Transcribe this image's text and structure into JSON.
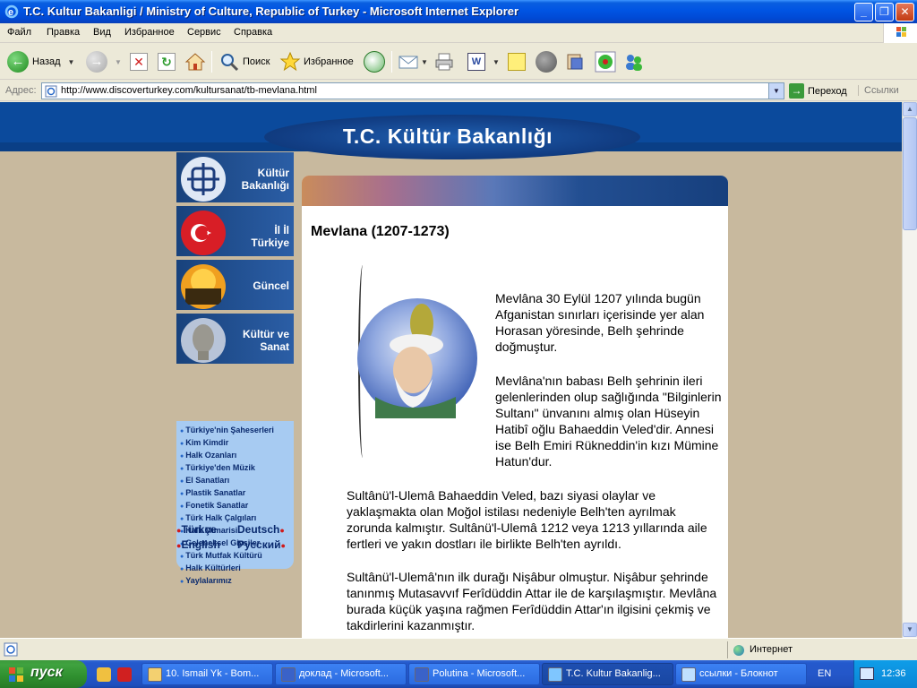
{
  "window": {
    "title": "T.C. Kultur Bakanligi / Ministry of Culture, Republic of Turkey - Microsoft Internet Explorer",
    "minimize": "_",
    "restore": "❐",
    "close": "✕"
  },
  "menu": [
    "Файл",
    "Правка",
    "Вид",
    "Избранное",
    "Сервис",
    "Справка"
  ],
  "toolbar": {
    "back_label": "Назад",
    "search_label": "Поиск",
    "favorites_label": "Избранное"
  },
  "address": {
    "label": "Адрес:",
    "url": "http://www.discoverturkey.com/kultursanat/tb-mevlana.html",
    "go_label": "Переход",
    "links_label": "Ссылки"
  },
  "page": {
    "banner_title": "T.C. Kültür Bakanlığı",
    "nav_tiles": [
      {
        "label": "Kültür Bakanlığı"
      },
      {
        "label": "İl İl Türkiye"
      },
      {
        "label": "Güncel"
      },
      {
        "label": "Kültür ve Sanat"
      }
    ],
    "sub_items": [
      "Türkiye'nin Şaheserleri",
      "Kim Kimdir",
      "Halk Ozanları",
      "Türkiye'den Müzik",
      "El Sanatları",
      "Plastik Sanatlar",
      "Fonetik Sanatlar",
      "Türk Halk Çalgıları",
      "Halk Mimarisi",
      "Geleneksel Giysiler",
      "Türk Mutfak Kültürü",
      "Halk Kültürleri",
      "Yaylalarımız"
    ],
    "languages": {
      "turkish": "Türkçe",
      "german": "Deutsch",
      "english": "English",
      "russian": "Русский"
    },
    "article": {
      "heading": "Mevlana (1207-1273)",
      "p1": "Mevlâna 30 Eylül 1207 yılında bugün Afganistan sınırları içerisinde yer alan Horasan yöresinde, Belh şehrinde doğmuştur.",
      "p2": "Mevlâna'nın babası Belh şehrinin ileri gelenlerinden olup sağlığında \"Bilginlerin Sultanı\" ünvanını almış olan Hüseyin Hatibî oğlu Bahaeddin Veled'dir. Annesi ise Belh Emiri Rükneddin'in kızı Mümine Hatun'dur.",
      "p3": "Sultânü'l-Ulemâ Bahaeddin Veled, bazı siyasi olaylar ve yaklaşmakta olan Moğol istilası nedeniyle Belh'ten ayrılmak zorunda kalmıştır. Sultânü'l-Ulemâ 1212 veya 1213 yıllarında aile fertleri ve yakın dostları ile birlikte Belh'ten ayrıldı.",
      "p4": "Sultânü'l-Ulemâ'nın ilk durağı Nişâbur olmuştur. Nişâbur şehrinde tanınmış Mutasavvıf Ferîdüddin Attar ile de karşılaşmıştır. Mevlâna burada küçük yaşına rağmen Ferîdüddin Attar'ın ilgisini çekmiş ve takdirlerini kazanmıştır."
    }
  },
  "status": {
    "zone": "Интернет"
  },
  "taskbar": {
    "start": "пуск",
    "tasks": [
      "10. Ismail Yk - Bom...",
      "доклад - Microsoft...",
      "Polutina - Microsoft...",
      "T.C. Kultur Bakanlig...",
      "ссылки - Блокнот"
    ],
    "lang": "EN",
    "clock": "12:36"
  }
}
